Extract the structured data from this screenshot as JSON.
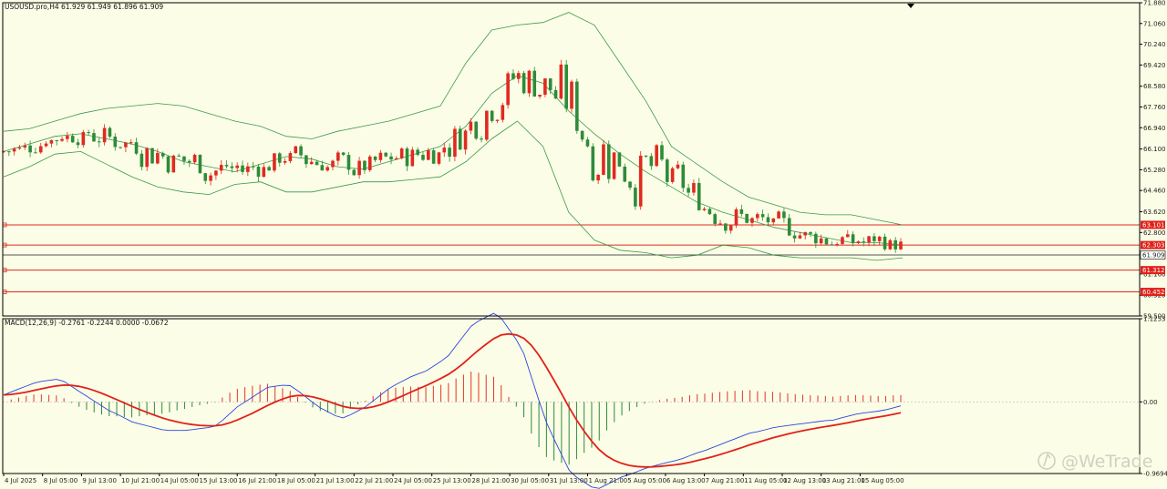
{
  "chart_data": {
    "type": "candlestick",
    "symbol_info": "USOUSD.pro,H4  61.929 61.949 61.896 61.909",
    "x_tick_labels": [
      "4 Jul 2025",
      "8 Jul 05:00",
      "9 Jul 13:00",
      "10 Jul 21:00",
      "14 Jul 05:00",
      "15 Jul 13:00",
      "16 Jul 21:00",
      "18 Jul 05:00",
      "21 Jul 13:00",
      "22 Jul 21:00",
      "24 Jul 05:00",
      "25 Jul 13:00",
      "28 Jul 21:00",
      "30 Jul 05:00",
      "31 Jul 13:00",
      "1 Aug 21:00",
      "5 Aug 05:00",
      "6 Aug 13:00",
      "7 Aug 21:00",
      "11 Aug 05:00",
      "12 Aug 13:00",
      "13 Aug 21:00",
      "15 Aug 05:00"
    ],
    "price_axis": {
      "ticks": [
        "71.880",
        "71.060",
        "70.240",
        "69.420",
        "68.580",
        "67.760",
        "66.940",
        "66.100",
        "65.280",
        "64.460",
        "63.620",
        "62.800",
        "61.160",
        "60.320",
        "59.500"
      ],
      "range": [
        59.5,
        71.88
      ]
    },
    "current_price": "61.909",
    "horizontal_levels": [
      {
        "label": "63.101",
        "value": 63.101
      },
      {
        "label": "62.303",
        "value": 62.303
      },
      {
        "label": "61.312",
        "value": 61.312
      },
      {
        "label": "60.452",
        "value": 60.452
      }
    ],
    "bollinger_bands": {
      "upper": [
        66.8,
        66.9,
        67.2,
        67.5,
        67.7,
        67.8,
        67.9,
        67.8,
        67.5,
        67.2,
        67.0,
        66.6,
        66.5,
        66.8,
        67.0,
        67.2,
        67.5,
        67.8,
        69.5,
        70.8,
        71.0,
        71.1,
        71.5,
        71.0,
        69.5,
        68.0,
        66.2,
        65.5,
        64.8,
        64.2,
        63.9,
        63.6,
        63.5,
        63.5,
        63.3,
        63.1
      ],
      "middle": [
        66.0,
        66.3,
        66.6,
        66.7,
        66.5,
        66.3,
        66.0,
        65.6,
        65.4,
        65.2,
        65.5,
        65.8,
        65.7,
        65.4,
        65.3,
        65.6,
        65.9,
        66.2,
        67.0,
        68.3,
        69.0,
        68.7,
        67.6,
        66.7,
        65.9,
        65.2,
        64.6,
        64.0,
        63.6,
        63.3,
        63.0,
        62.8,
        62.6,
        62.4,
        62.4,
        62.3
      ],
      "lower": [
        65.0,
        65.4,
        65.9,
        66.0,
        65.5,
        65.0,
        64.6,
        64.4,
        64.3,
        64.7,
        64.8,
        64.4,
        64.4,
        64.6,
        64.8,
        64.8,
        64.9,
        65.0,
        65.6,
        66.5,
        67.2,
        66.2,
        63.6,
        62.5,
        62.1,
        62.0,
        61.8,
        61.9,
        62.3,
        62.2,
        61.9,
        61.8,
        61.8,
        61.8,
        61.7,
        61.8
      ]
    },
    "macd": {
      "label": "MACD(12,26,9) -0.2761 -0.2244 0.0000 -0.0672",
      "ticks": [
        "1.1253",
        "0.00",
        "-0.9694"
      ],
      "range": [
        -0.9694,
        1.1253
      ]
    },
    "watermark": "@WeTrade"
  }
}
